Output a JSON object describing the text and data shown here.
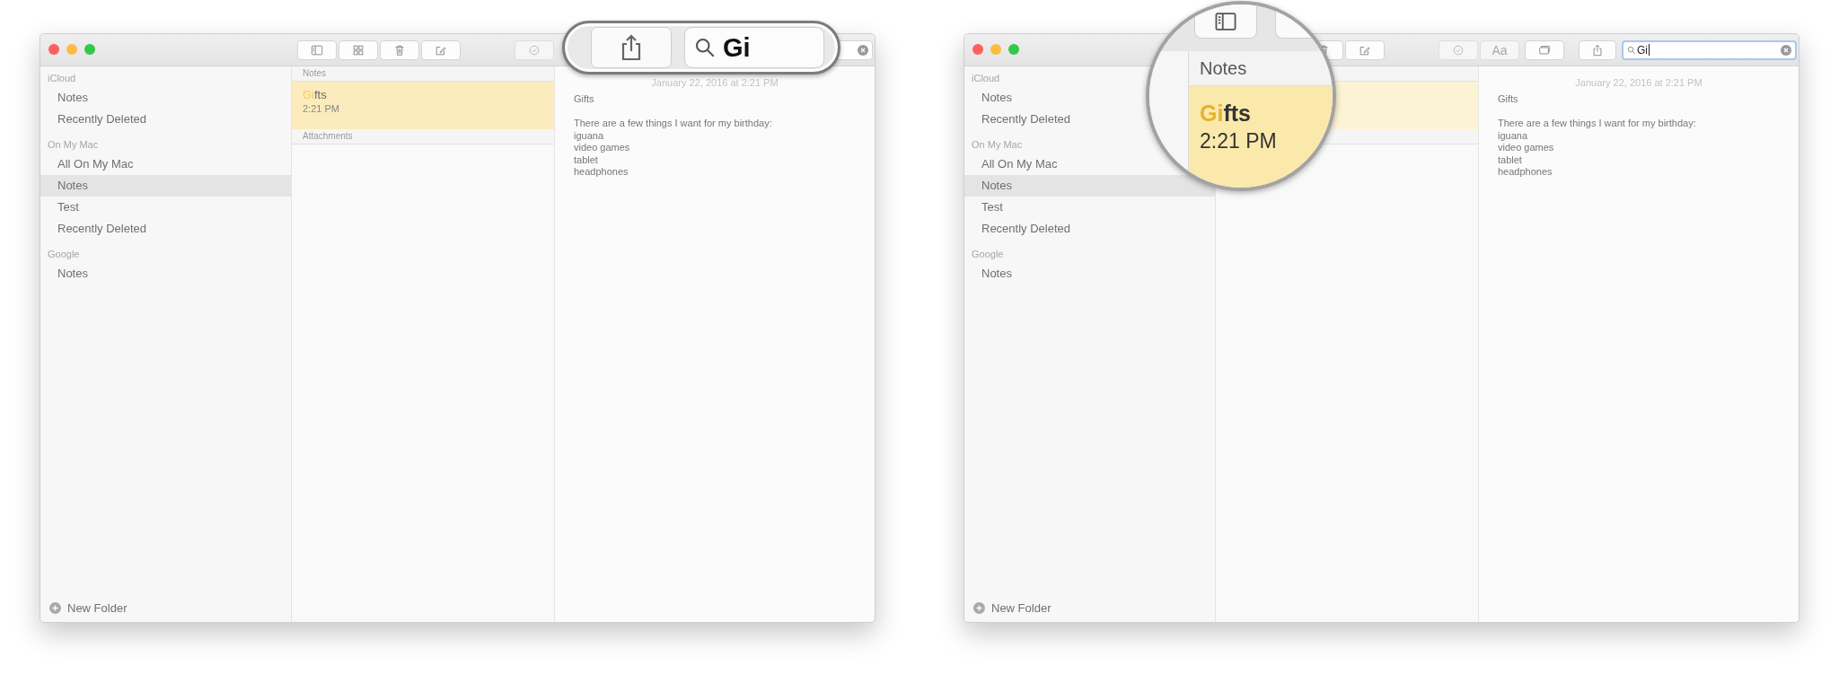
{
  "windows": [
    {
      "toolbar": [
        {
          "kind": "sidebar",
          "disabled": false
        },
        {
          "kind": "grid",
          "disabled": false
        },
        {
          "kind": "trash",
          "disabled": false
        },
        {
          "kind": "compose",
          "disabled": false
        },
        {
          "kind": "checklist",
          "disabled": true
        }
      ],
      "search": {
        "clear": true
      },
      "sidebar": [
        {
          "title": "iCloud",
          "items": [
            {
              "label": "Notes",
              "selected": false
            },
            {
              "label": "Recently Deleted",
              "selected": false
            }
          ]
        },
        {
          "title": "On My Mac",
          "items": [
            {
              "label": "All On My Mac",
              "selected": false
            },
            {
              "label": "Notes",
              "selected": true
            },
            {
              "label": "Test",
              "selected": false
            },
            {
              "label": "Recently Deleted",
              "selected": false
            }
          ]
        },
        {
          "title": "Google",
          "items": [
            {
              "label": "Notes",
              "selected": false
            }
          ]
        }
      ],
      "new_folder": "New Folder",
      "list": {
        "header": "Notes",
        "notes": [
          {
            "title_match": "Gi",
            "title_rest": "fts",
            "time": "2:21 PM",
            "focused": true
          }
        ],
        "attachments": "Attachments"
      },
      "note": {
        "date": "January 22, 2016 at 2:21 PM",
        "title": "Gifts",
        "lines": [
          "There are a few things I want for my birthday:",
          "iguana",
          "video games",
          "tablet",
          "headphones"
        ]
      },
      "magnifier": {
        "kind": "pill",
        "buttons": [
          {
            "kind": "share"
          }
        ],
        "search": {
          "value": "Gi"
        }
      }
    },
    {
      "toolbar": [
        {
          "kind": "trash",
          "disabled": false
        },
        {
          "kind": "compose",
          "disabled": false
        },
        {
          "kind": "checklist",
          "disabled": true
        },
        {
          "kind": "aa",
          "label": "Aa",
          "disabled": true
        },
        {
          "kind": "gallery",
          "disabled": false
        },
        {
          "kind": "share",
          "disabled": false
        }
      ],
      "search": {
        "value": "Gi",
        "clear": true
      },
      "sidebar": [
        {
          "title": "iCloud",
          "items": [
            {
              "label": "Notes",
              "selected": false
            },
            {
              "label": "Recently Deleted",
              "selected": false
            }
          ]
        },
        {
          "title": "On My Mac",
          "items": [
            {
              "label": "All On My Mac",
              "selected": false
            },
            {
              "label": "Notes",
              "selected": true
            },
            {
              "label": "Test",
              "selected": false
            },
            {
              "label": "Recently Deleted",
              "selected": false
            }
          ]
        },
        {
          "title": "Google",
          "items": [
            {
              "label": "Notes",
              "selected": false
            }
          ]
        }
      ],
      "new_folder": "New Folder",
      "list": {
        "notes": [
          {
            "focused": false
          }
        ]
      },
      "note": {
        "date": "January 22, 2016 at 2:21 PM",
        "title": "Gifts",
        "lines": [
          "There are a few things I want for my birthday:",
          "iguana",
          "video games",
          "tablet",
          "headphones"
        ]
      },
      "magnifier": {
        "kind": "circle",
        "buttons": [
          {
            "kind": "sidebar"
          },
          {
            "kind": "blank"
          }
        ],
        "list_header": "Notes",
        "note": {
          "title_match": "Gi",
          "title_rest": "fts",
          "time": "2:21 PM"
        }
      }
    }
  ]
}
